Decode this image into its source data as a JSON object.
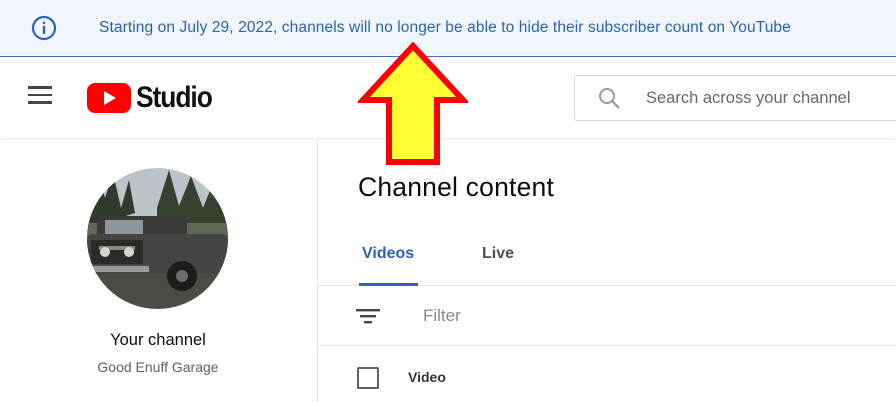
{
  "banner": {
    "text": "Starting on July 29, 2022, channels will no longer be able to hide their subscriber count on YouTube",
    "icon": "info-icon",
    "color": "#2a62b5"
  },
  "header": {
    "logo_text": "Studio",
    "search_placeholder": "Search across your channel",
    "brand_red": "#ff0000"
  },
  "sidebar": {
    "channel_label": "Your channel",
    "channel_name": "Good Enuff Garage"
  },
  "main": {
    "title": "Channel content",
    "tabs": [
      {
        "label": "Videos",
        "active": true
      },
      {
        "label": "Live",
        "active": false
      }
    ],
    "filter_label": "Filter",
    "table_header": "Video"
  },
  "annotation": {
    "arrow_fill": "#ffff33",
    "arrow_stroke": "#ff0000"
  }
}
